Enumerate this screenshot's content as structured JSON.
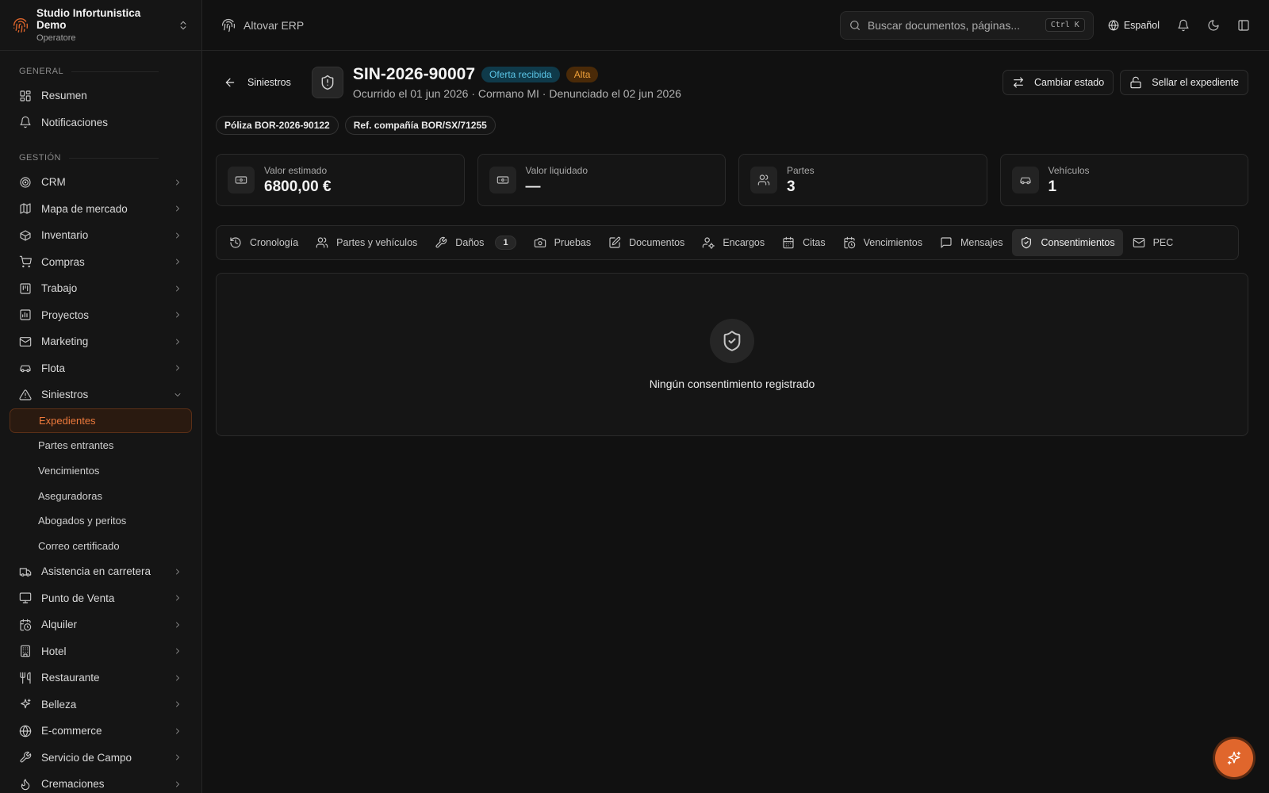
{
  "org": {
    "name": "Studio Infortunistica Demo",
    "role": "Operatore"
  },
  "sidebar": {
    "general_label": "GENERAL",
    "general_items": [
      {
        "label": "Resumen",
        "icon": "dashboard-icon"
      },
      {
        "label": "Notificaciones",
        "icon": "bell-icon"
      }
    ],
    "management_label": "GESTIÓN",
    "management_items": [
      {
        "label": "CRM",
        "icon": "target-icon"
      },
      {
        "label": "Mapa de mercado",
        "icon": "map-icon"
      },
      {
        "label": "Inventario",
        "icon": "box-icon"
      },
      {
        "label": "Compras",
        "icon": "cart-icon"
      },
      {
        "label": "Trabajo",
        "icon": "kanban-icon"
      },
      {
        "label": "Proyectos",
        "icon": "chart-icon"
      },
      {
        "label": "Marketing",
        "icon": "mail-icon"
      },
      {
        "label": "Flota",
        "icon": "car-icon"
      },
      {
        "label": "Siniestros",
        "icon": "warning-icon"
      }
    ],
    "claims_sub": [
      {
        "label": "Expedientes",
        "active": true
      },
      {
        "label": "Partes entrantes"
      },
      {
        "label": "Vencimientos"
      },
      {
        "label": "Aseguradoras"
      },
      {
        "label": "Abogados y peritos"
      },
      {
        "label": "Correo certificado"
      }
    ],
    "more_items": [
      {
        "label": "Asistencia en carretera",
        "icon": "truck-icon"
      },
      {
        "label": "Punto de Venta",
        "icon": "monitor-icon"
      },
      {
        "label": "Alquiler",
        "icon": "calendar-clock-icon"
      },
      {
        "label": "Hotel",
        "icon": "building-icon"
      },
      {
        "label": "Restaurante",
        "icon": "utensils-icon"
      },
      {
        "label": "Belleza",
        "icon": "sparkles-icon"
      },
      {
        "label": "E-commerce",
        "icon": "globe-icon"
      },
      {
        "label": "Servicio de Campo",
        "icon": "wrench-icon"
      },
      {
        "label": "Cremaciones",
        "icon": "flame-icon"
      }
    ]
  },
  "topbar": {
    "brand": "Altovar ERP",
    "search_placeholder": "Buscar documentos, páginas...",
    "shortcut": "Ctrl K",
    "language": "Español"
  },
  "header": {
    "back_label": "Siniestros",
    "case_id": "SIN-2026-90007",
    "status_badge": "Oferta recibida",
    "priority_badge": "Alta",
    "subtitle": "Ocurrido el 01 jun 2026 · Cormano MI · Denunciado el 02 jun 2026",
    "change_status_label": "Cambiar estado",
    "seal_label": "Sellar el expediente"
  },
  "chips": {
    "policy": "Póliza BOR-2026-90122",
    "company_ref": "Ref. compañía BOR/SX/71255"
  },
  "stats": [
    {
      "label": "Valor estimado",
      "value": "6800,00 €",
      "icon": "banknote-icon"
    },
    {
      "label": "Valor liquidado",
      "value": "—",
      "icon": "banknote-icon"
    },
    {
      "label": "Partes",
      "value": "3",
      "icon": "users-icon"
    },
    {
      "label": "Vehículos",
      "value": "1",
      "icon": "car-icon"
    }
  ],
  "tabs": [
    {
      "label": "Cronología",
      "icon": "history-icon"
    },
    {
      "label": "Partes y vehículos",
      "icon": "users-icon"
    },
    {
      "label": "Daños",
      "icon": "wrench-icon",
      "count": "1"
    },
    {
      "label": "Pruebas",
      "icon": "camera-icon"
    },
    {
      "label": "Documentos",
      "icon": "file-edit-icon"
    },
    {
      "label": "Encargos",
      "icon": "user-cog-icon"
    },
    {
      "label": "Citas",
      "icon": "calendar-icon"
    },
    {
      "label": "Vencimientos",
      "icon": "calendar-clock-icon"
    },
    {
      "label": "Mensajes",
      "icon": "message-icon"
    },
    {
      "label": "Consentimientos",
      "icon": "shield-check-icon",
      "active": true
    },
    {
      "label": "PEC",
      "icon": "mail-icon"
    }
  ],
  "empty_state": {
    "text": "Ningún consentimiento registrado"
  }
}
